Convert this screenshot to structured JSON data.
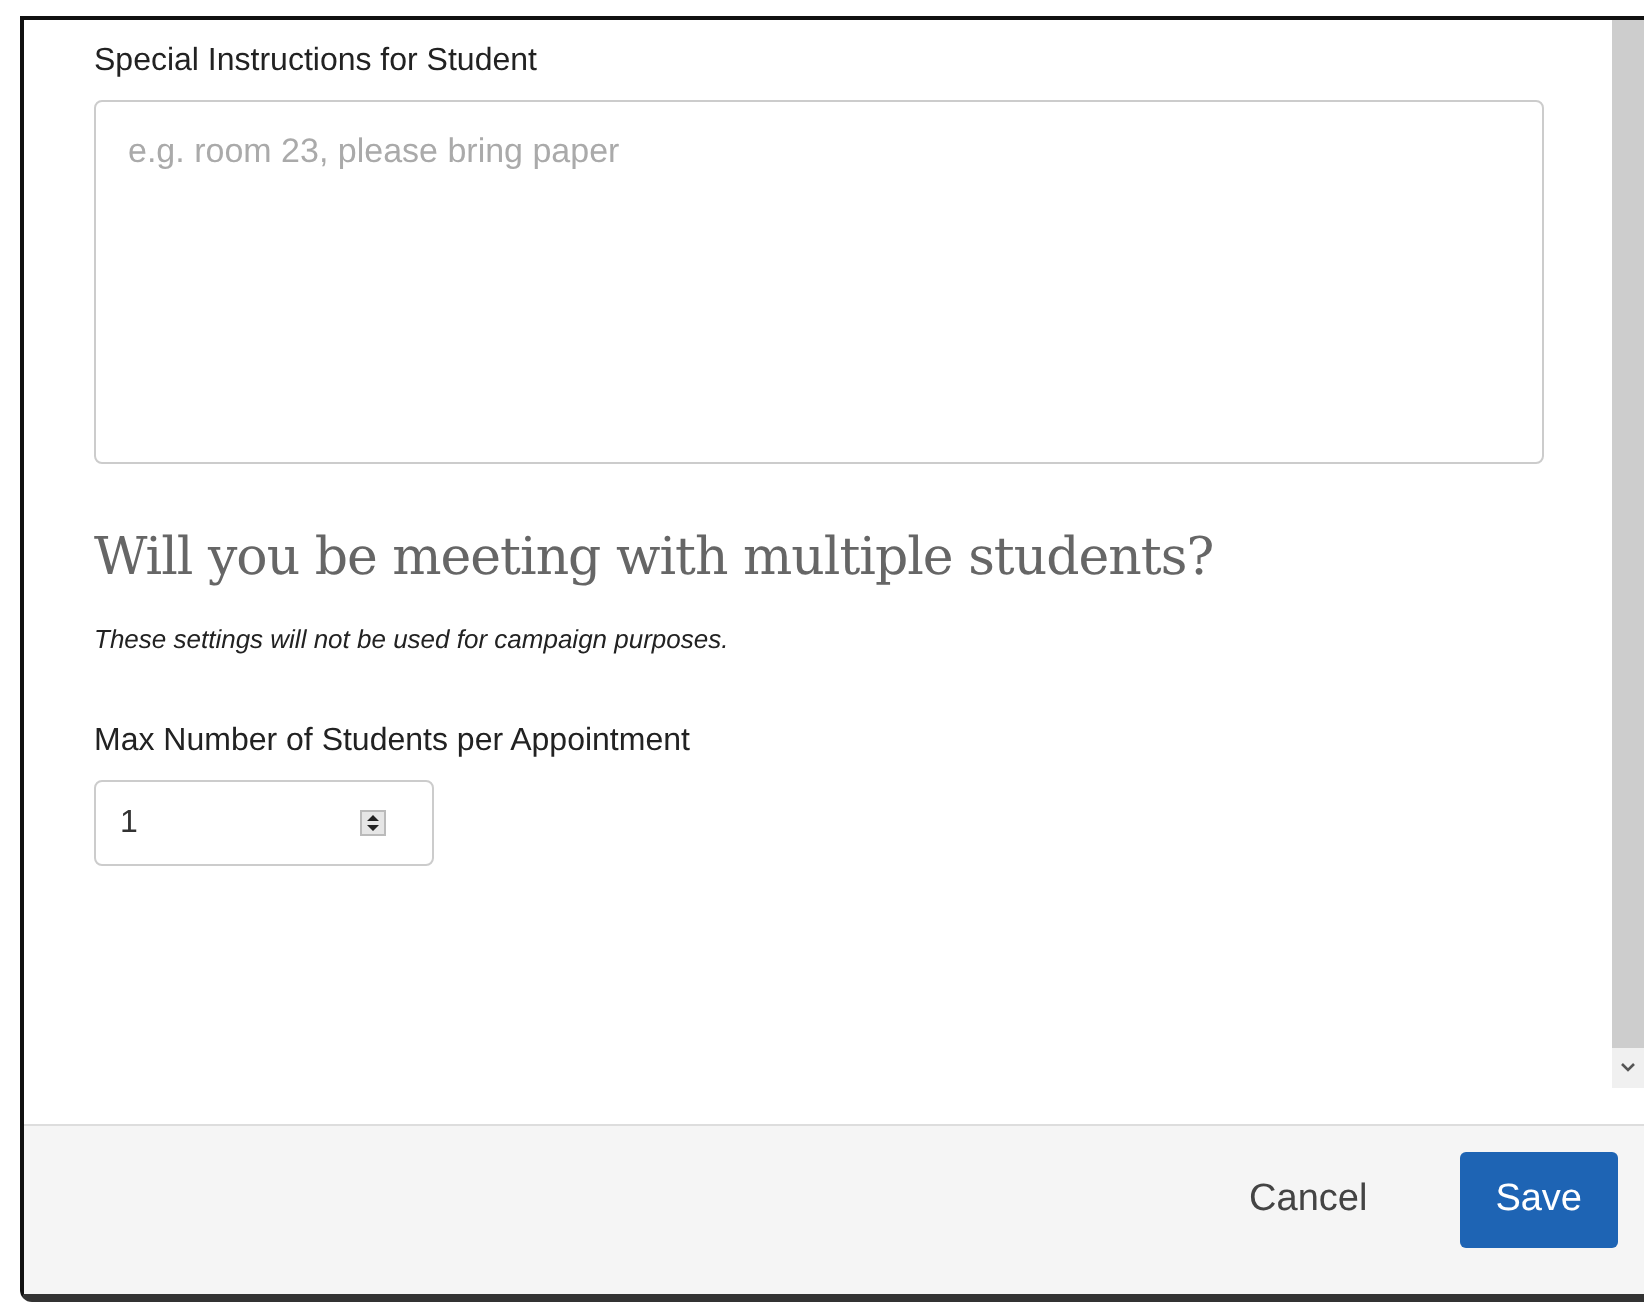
{
  "instructions": {
    "label": "Special Instructions for Student",
    "placeholder": "e.g. room 23, please bring paper"
  },
  "group_section": {
    "heading": "Will you be meeting with multiple students?",
    "note": "These settings will not be used for campaign purposes.",
    "max_label": "Max Number of Students per Appointment",
    "max_value": "1"
  },
  "footer": {
    "buttons": [
      {
        "label": "Cancel",
        "kind": "link"
      },
      {
        "label": "Save",
        "kind": "primary"
      }
    ]
  }
}
